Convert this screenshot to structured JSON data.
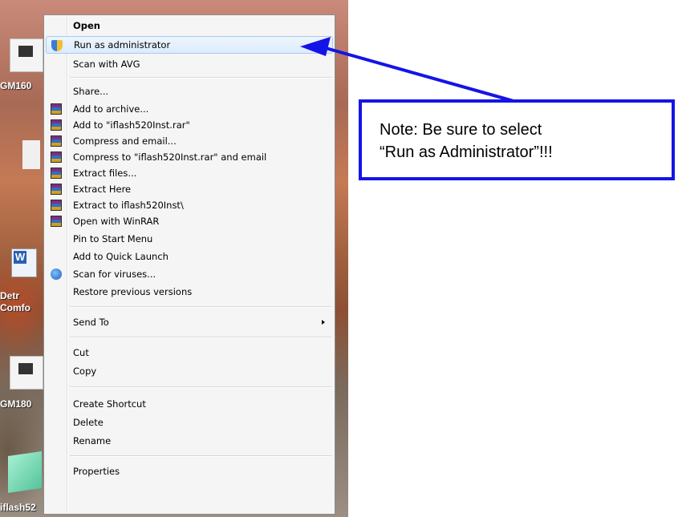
{
  "desktop": {
    "labels": [
      "GM160",
      "Detr",
      "Comfo",
      "GM180",
      "iflash52"
    ]
  },
  "context_menu": {
    "items": [
      {
        "label": "Open",
        "bold": true
      },
      {
        "label": "Run as administrator",
        "icon": "shield-icon",
        "highlighted": true
      },
      {
        "label": "Scan with AVG"
      },
      {
        "label": "Share..."
      },
      {
        "label": "Add to archive...",
        "icon": "winrar-icon"
      },
      {
        "label": "Add to \"iflash520Inst.rar\"",
        "icon": "winrar-icon"
      },
      {
        "label": "Compress and email...",
        "icon": "winrar-icon"
      },
      {
        "label": "Compress to \"iflash520Inst.rar\" and email",
        "icon": "winrar-icon"
      },
      {
        "label": "Extract files...",
        "icon": "winrar-icon"
      },
      {
        "label": "Extract Here",
        "icon": "winrar-icon"
      },
      {
        "label": "Extract to iflash520Inst\\",
        "icon": "winrar-icon"
      },
      {
        "label": "Open with WinRAR",
        "icon": "winrar-icon"
      },
      {
        "label": "Pin to Start Menu"
      },
      {
        "label": "Add to Quick Launch"
      },
      {
        "label": "Scan for viruses...",
        "icon": "antivirus-icon"
      },
      {
        "label": "Restore previous versions"
      },
      {
        "label": "Send To",
        "submenu": true
      },
      {
        "label": "Cut"
      },
      {
        "label": "Copy"
      },
      {
        "label": "Create Shortcut"
      },
      {
        "label": "Delete"
      },
      {
        "label": "Rename"
      },
      {
        "label": "Properties"
      }
    ]
  },
  "note": {
    "line1": "Note: Be sure to select",
    "line2": "“Run as Administrator”!!!"
  },
  "colors": {
    "note_border": "#1414e6",
    "arrow": "#1414e6",
    "highlight": "#dcebfc"
  }
}
